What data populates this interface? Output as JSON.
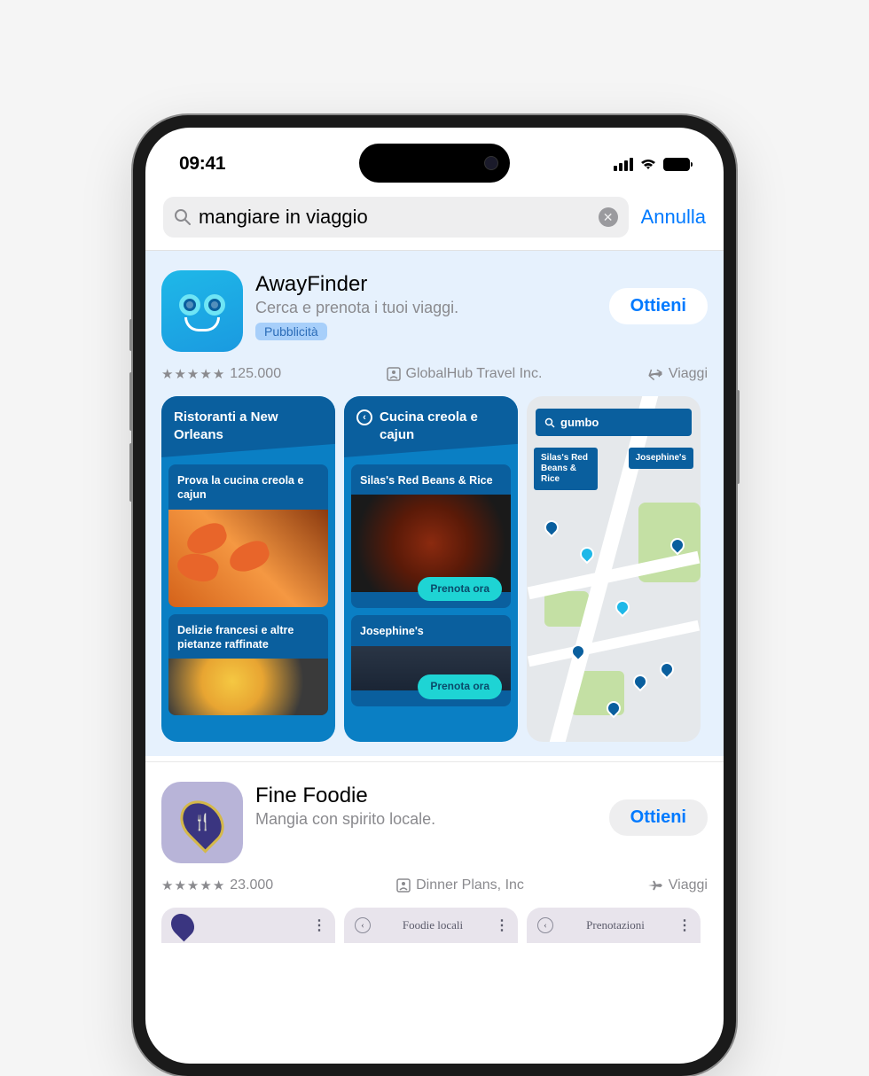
{
  "status": {
    "time": "09:41"
  },
  "search": {
    "query": "mangiare in viaggio",
    "cancel": "Annulla"
  },
  "sponsored": {
    "name": "AwayFinder",
    "subtitle": "Cerca e prenota i tuoi viaggi.",
    "ad_badge": "Pubblicità",
    "get": "Ottieni",
    "ratings": "125.000",
    "developer": "GlobalHub Travel Inc.",
    "category": "Viaggi",
    "shots": {
      "s1": {
        "title": "Ristoranti a New Orleans",
        "card1": "Prova la cucina creola e cajun",
        "card2": "Delizie francesi e altre pietanze raffinate"
      },
      "s2": {
        "title": "Cucina creola e cajun",
        "card1": "Silas's Red Beans & Rice",
        "card2": "Josephine's",
        "book": "Prenota ora"
      },
      "s3": {
        "search": "gumbo",
        "pin1": "Silas's Red Beans & Rice",
        "pin2": "Josephine's"
      }
    }
  },
  "organic": {
    "name": "Fine Foodie",
    "subtitle": "Mangia con spirito locale.",
    "get": "Ottieni",
    "ratings": "23.000",
    "developer": "Dinner Plans, Inc",
    "category": "Viaggi",
    "mini": {
      "m2": "Foodie locali",
      "m3": "Prenotazioni"
    }
  }
}
